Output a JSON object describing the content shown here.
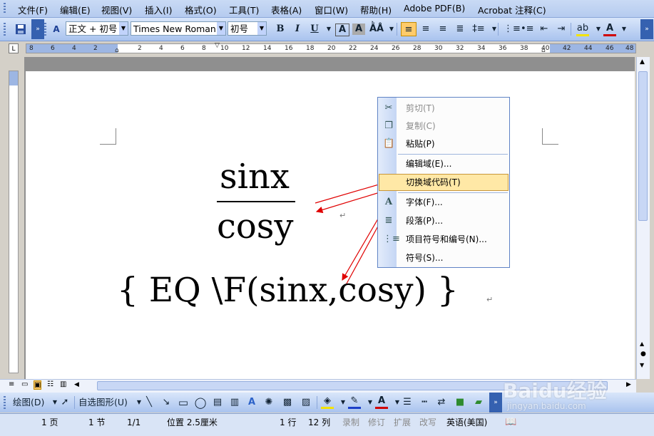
{
  "menubar": {
    "items": [
      "文件(F)",
      "编辑(E)",
      "视图(V)",
      "插入(I)",
      "格式(O)",
      "工具(T)",
      "表格(A)",
      "窗口(W)",
      "帮助(H)",
      "Adobe PDF(B)",
      "Acrobat 注释(C)"
    ]
  },
  "format_toolbar": {
    "style_value": "正文 + 初号",
    "font_value": "Times New Roman",
    "size_value": "初号",
    "bold": "B",
    "italic": "I",
    "underline": "U"
  },
  "ruler": {
    "numbers": [
      "8",
      "6",
      "4",
      "2",
      "2",
      "4",
      "6",
      "8",
      "10",
      "12",
      "14",
      "16",
      "18",
      "20",
      "22",
      "24",
      "26",
      "28",
      "30",
      "32",
      "34",
      "36",
      "38",
      "40",
      "42",
      "44",
      "46",
      "48"
    ]
  },
  "document": {
    "numerator": "sinx",
    "denominator": "cosy",
    "field_code": "{  EQ \\F(sinx,cosy)  }",
    "paragraph_mark": "↵"
  },
  "context_menu": {
    "items": [
      {
        "label": "剪切(T)",
        "icon": "scissors-icon",
        "disabled": true
      },
      {
        "label": "复制(C)",
        "icon": "copy-icon",
        "disabled": true
      },
      {
        "label": "粘贴(P)",
        "icon": "paste-icon",
        "disabled": false
      },
      {
        "label": "编辑域(E)...",
        "icon": "",
        "disabled": false
      },
      {
        "label": "切换域代码(T)",
        "icon": "",
        "disabled": false,
        "highlighted": true
      },
      {
        "label": "字体(F)...",
        "icon": "font-icon",
        "disabled": false
      },
      {
        "label": "段落(P)...",
        "icon": "paragraph-icon",
        "disabled": false
      },
      {
        "label": "项目符号和编号(N)...",
        "icon": "bullets-icon",
        "disabled": false
      },
      {
        "label": "符号(S)...",
        "icon": "",
        "disabled": false
      }
    ]
  },
  "drawing_toolbar": {
    "draw_label": "绘图(D)",
    "autoshape_label": "自选图形(U)"
  },
  "statusbar": {
    "page": "1 页",
    "section": "1 节",
    "page_of": "1/1",
    "position": "位置 2.5厘米",
    "line": "1 行",
    "column": "12 列",
    "rec": "录制",
    "trk": "修订",
    "ext": "扩展",
    "ovr": "改写",
    "language": "英语(美国)"
  },
  "watermark": {
    "brand": "Baidu经验",
    "url": "jingyan.baidu.com"
  },
  "colors": {
    "menubar": "#c9daf5",
    "highlight": "#ffe8a6",
    "annotation_arrow": "#e00000"
  }
}
